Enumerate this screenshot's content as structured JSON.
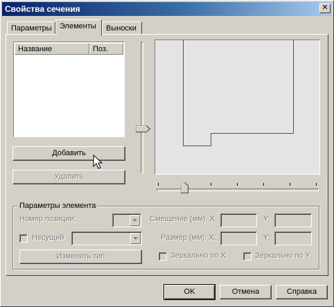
{
  "window": {
    "title": "Свойства сечения",
    "close_glyph": "✕"
  },
  "tabs": [
    {
      "label": "Параметры",
      "active": false
    },
    {
      "label": "Элементы",
      "active": true
    },
    {
      "label": "Выноски",
      "active": false
    }
  ],
  "elements_list": {
    "columns": [
      "Название",
      "Поз."
    ],
    "rows": []
  },
  "buttons": {
    "add": "Добавить",
    "delete": "Удалить",
    "change_type": "Изменить тип",
    "ok": "OK",
    "cancel": "Отмена",
    "help": "Справка"
  },
  "element_params": {
    "group_title": "Параметры элемента",
    "position_number_label": "Номер позиции:",
    "bearing_label": "Несущий",
    "offset_label": "Смещение (мм): X:",
    "offset_y_label": "Y:",
    "size_label": "Размер (мм): X:",
    "size_y_label": "Y:",
    "mirror_x_label": "Зеркально по X",
    "mirror_y_label": "Зеркально по Y"
  },
  "colors": {
    "face": "#d4d0c8",
    "preview_bg": "#e4e4e4",
    "title_start": "#0a246a",
    "title_end": "#a6caf0",
    "disabled_text": "#808080"
  }
}
